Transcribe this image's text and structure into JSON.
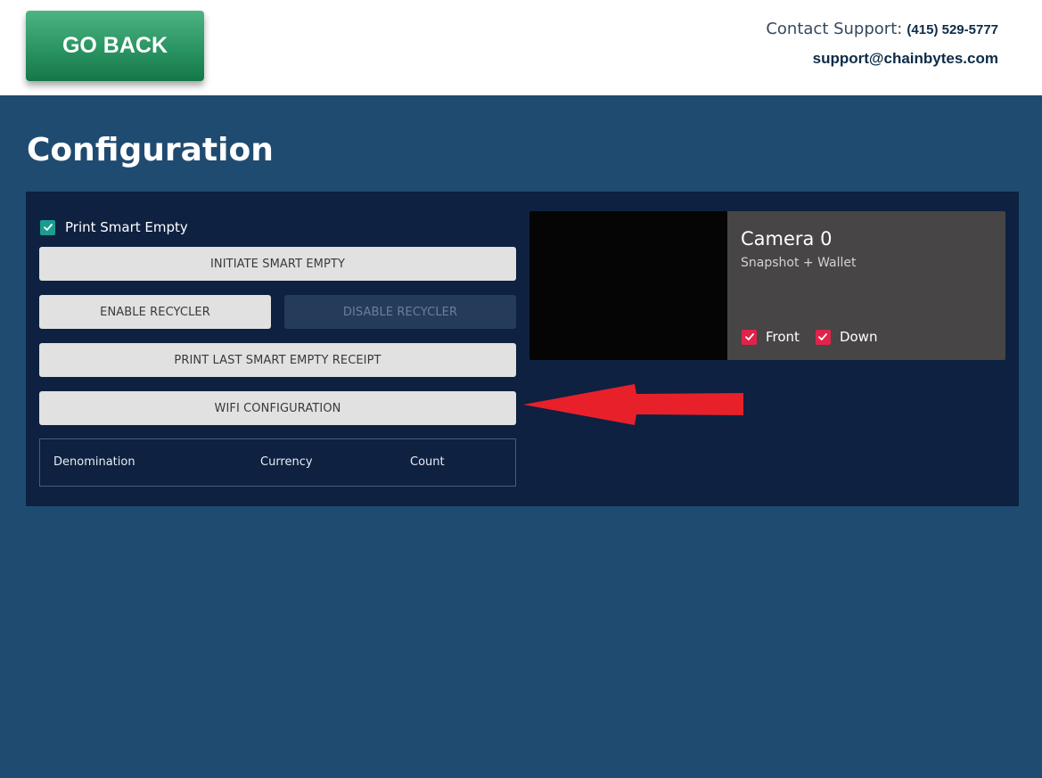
{
  "header": {
    "go_back_label": "GO BACK",
    "contact_label": "Contact Support:",
    "contact_phone": "(415) 529-5777",
    "contact_email": "support@chainbytes.com"
  },
  "page": {
    "title": "Configuration"
  },
  "config": {
    "print_smart_empty_label": "Print Smart Empty",
    "print_smart_empty_checked": true,
    "initiate_smart_empty_label": "INITIATE SMART EMPTY",
    "enable_recycler_label": "ENABLE RECYCLER",
    "disable_recycler_label": "DISABLE RECYCLER",
    "disable_recycler_disabled": true,
    "print_last_receipt_label": "PRINT LAST SMART EMPTY RECEIPT",
    "wifi_configuration_label": "WIFI CONFIGURATION"
  },
  "table": {
    "columns": [
      "Denomination",
      "Currency",
      "Count"
    ],
    "rows": []
  },
  "camera": {
    "title": "Camera 0",
    "subtitle": "Snapshot + Wallet",
    "options": [
      {
        "label": "Front",
        "checked": true
      },
      {
        "label": "Down",
        "checked": true
      }
    ]
  },
  "colors": {
    "page_background": "#1f4b70",
    "panel_background": "#0e2140",
    "go_back_green": "#2a9462",
    "checkbox_teal": "#1a9c8f",
    "checkbox_red": "#e0234a",
    "annotation_arrow": "#e8202a"
  },
  "icons": {
    "checkmark": "check-icon",
    "annotation": "red-arrow-pointing-left"
  }
}
